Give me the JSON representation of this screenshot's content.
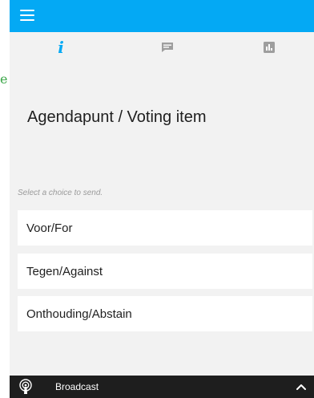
{
  "tabs": {
    "info_glyph": "i",
    "info_icon": "info-icon",
    "chat_icon": "chat-icon",
    "results_icon": "bar-chart-icon",
    "active_color": "#04a9f4",
    "inactive_color": "#9e9e9e"
  },
  "colors": {
    "accent": "#04a9f4",
    "panel_background": "#f2f2f2",
    "bottom_bar": "#1e1e1e"
  },
  "edge_mark": "e",
  "voting_item": {
    "title": "Agendapunt / Voting item"
  },
  "choices": {
    "prompt": "Select a choice to send.",
    "options": [
      {
        "label": "Voor/For"
      },
      {
        "label": "Tegen/Against"
      },
      {
        "label": "Onthouding/Abstain"
      }
    ]
  },
  "bottom_bar": {
    "icon": "broadcast-icon",
    "label": "Broadcast",
    "expand_icon": "chevron-up-icon"
  }
}
